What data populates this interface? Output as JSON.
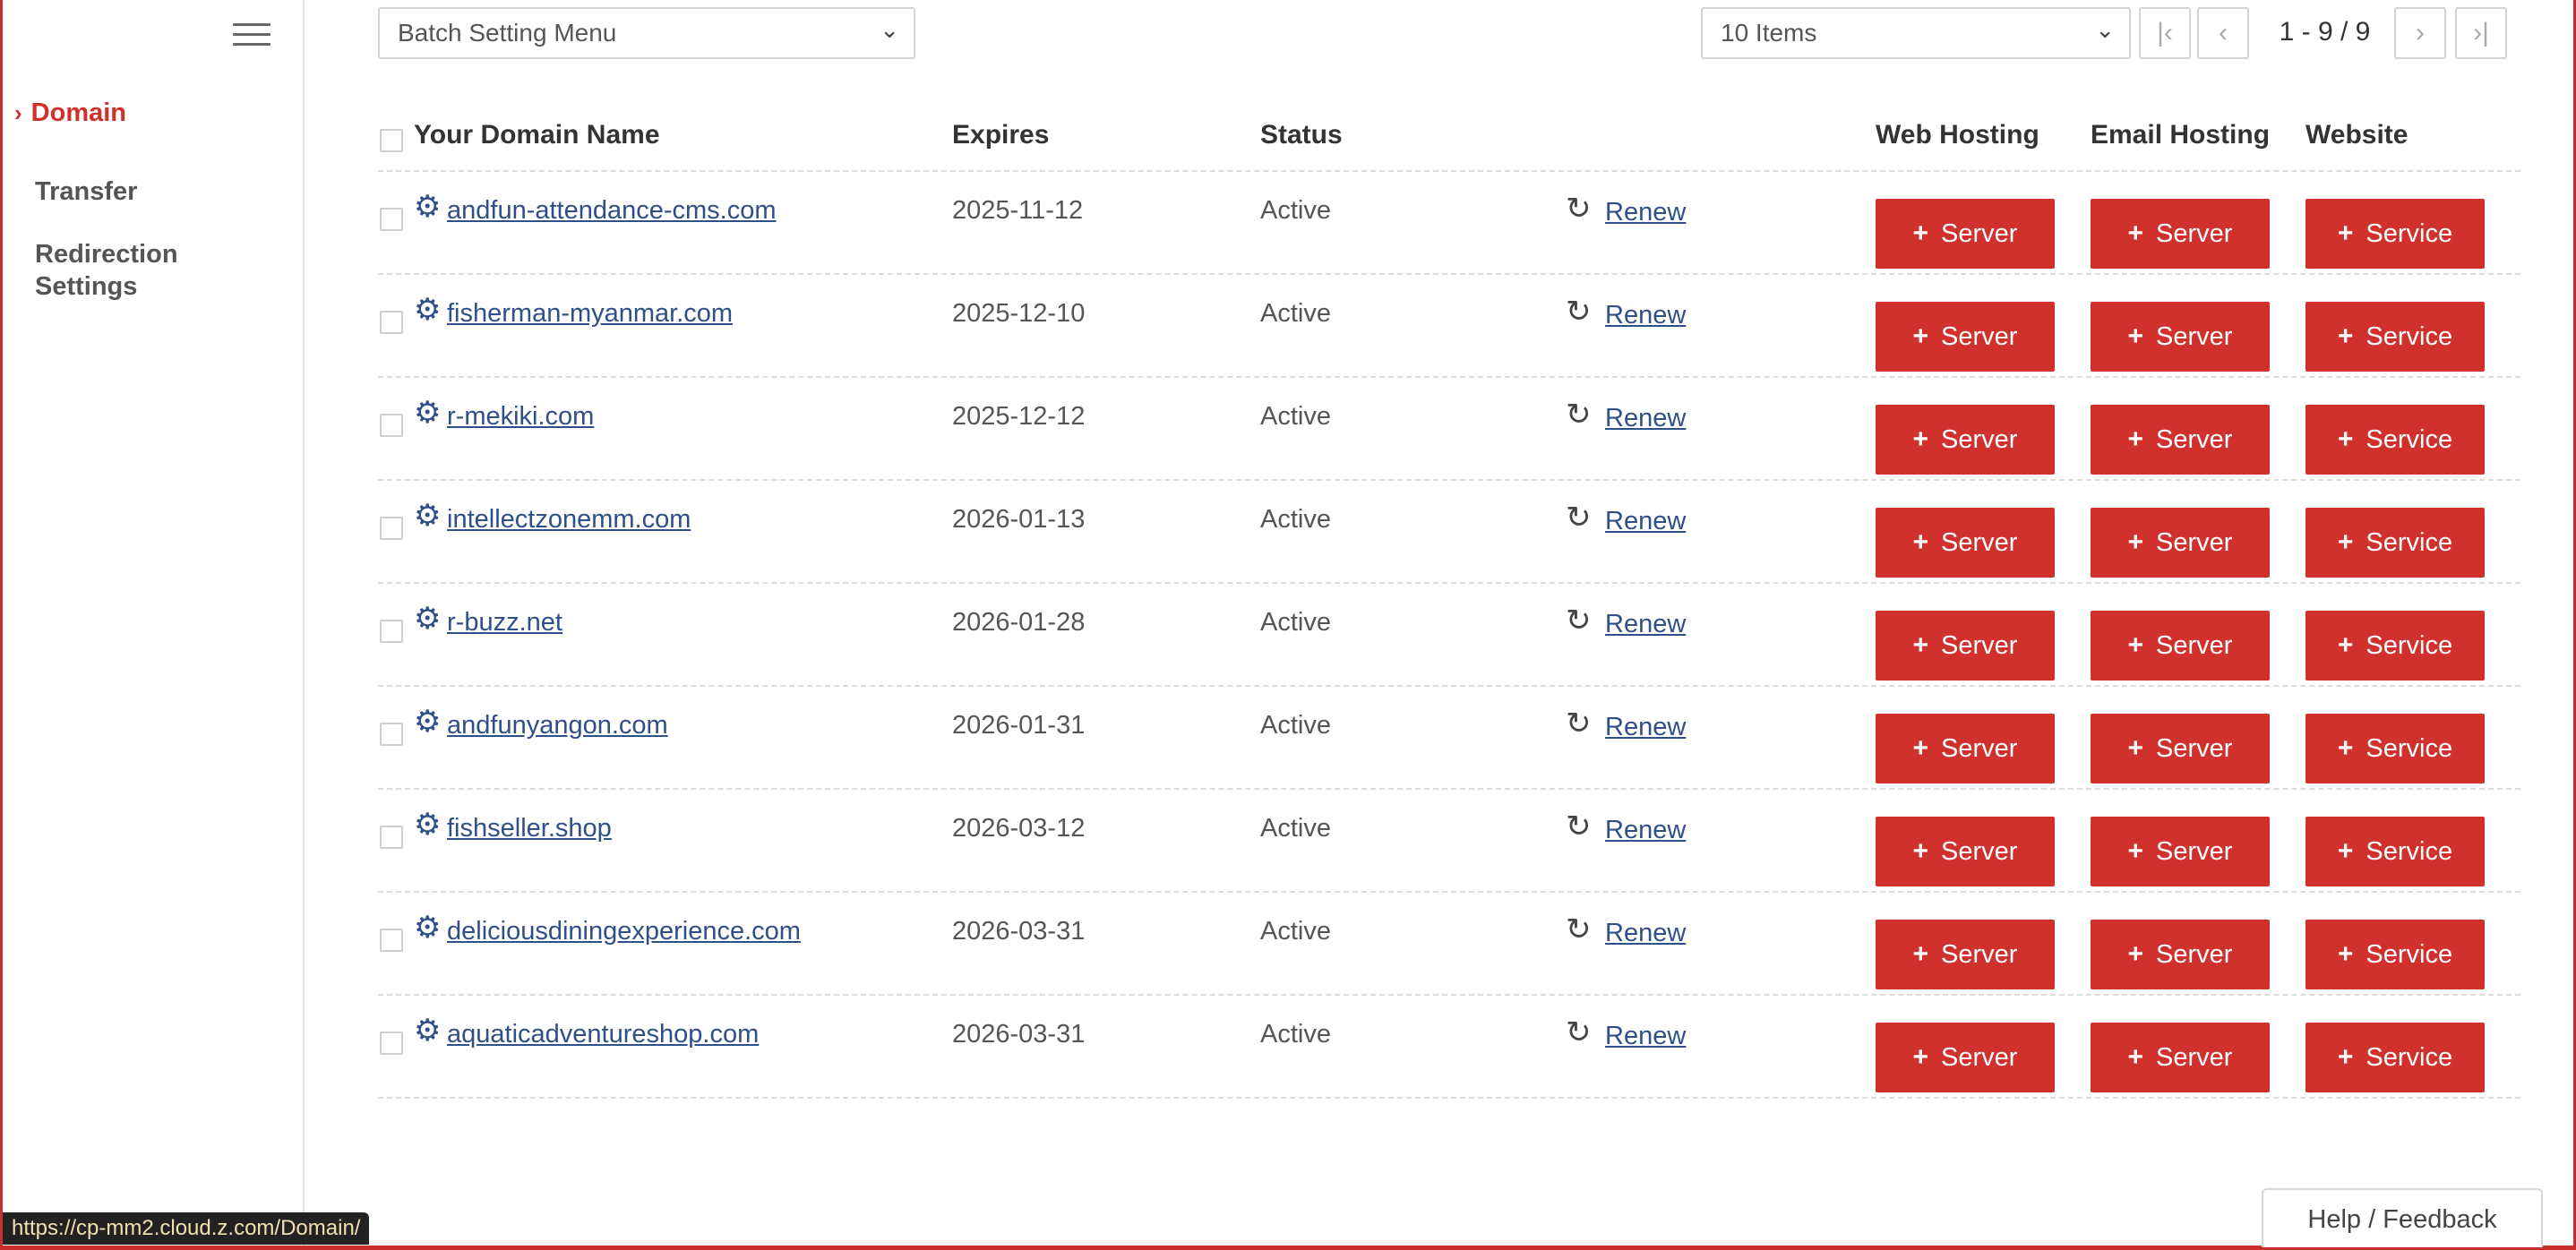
{
  "sidebar": {
    "menu_icon": "hamburger-icon",
    "items": [
      {
        "label": "Domain",
        "active": true
      },
      {
        "label": "Transfer"
      },
      {
        "label": "Redirection Settings"
      }
    ]
  },
  "toolbar": {
    "batch_select": "Batch Setting Menu",
    "items_select": "10 Items",
    "pagination": "1 - 9 / 9",
    "first_icon": "first-page-icon",
    "prev_icon": "prev-page-icon",
    "next_icon": "next-page-icon",
    "last_icon": "last-page-icon"
  },
  "table": {
    "headers": {
      "domain": "Your Domain Name",
      "expires": "Expires",
      "status": "Status",
      "web": "Web Hosting",
      "email": "Email Hosting",
      "website": "Website"
    },
    "renew_label": "Renew",
    "web_button": "Server",
    "email_button": "Server",
    "website_button": "Service",
    "rows": [
      {
        "domain": " andfun-attendance-cms.com",
        "expires": "2025-11-12",
        "status": "Active"
      },
      {
        "domain": " fisherman-myanmar.com",
        "expires": "2025-12-10",
        "status": "Active"
      },
      {
        "domain": " r-mekiki.com",
        "expires": "2025-12-12",
        "status": "Active"
      },
      {
        "domain": " intellectzonemm.com",
        "expires": "2026-01-13",
        "status": "Active"
      },
      {
        "domain": " r-buzz.net",
        "expires": "2026-01-28",
        "status": "Active"
      },
      {
        "domain": " andfunyangon.com",
        "expires": "2026-01-31",
        "status": "Active"
      },
      {
        "domain": " fishseller.shop",
        "expires": "2026-03-12",
        "status": "Active"
      },
      {
        "domain": " deliciousdiningexperience.com",
        "expires": "2026-03-31",
        "status": "Active"
      },
      {
        "domain": " aquaticadventureshop.com",
        "expires": "2026-03-31",
        "status": "Active"
      }
    ]
  },
  "status_url": "https://cp-mm2.cloud.z.com/Domain/",
  "help_label": "Help / Feedback",
  "colors": {
    "accent": "#d0312d",
    "link": "#2f4f88"
  }
}
